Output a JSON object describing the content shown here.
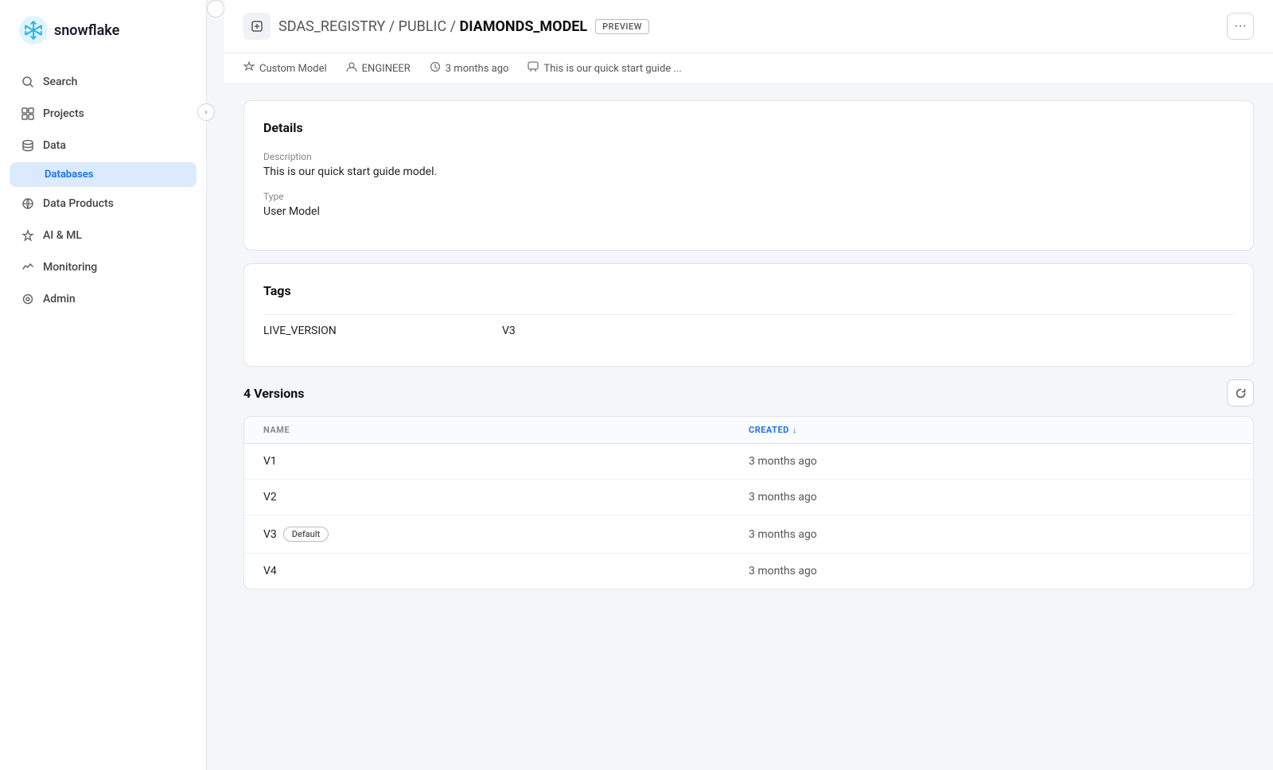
{
  "sidebar": {
    "logo_text": "snowflake",
    "items": [
      {
        "id": "search",
        "label": "Search",
        "icon": "🔍"
      },
      {
        "id": "projects",
        "label": "Projects",
        "icon": "⊞"
      },
      {
        "id": "data",
        "label": "Data",
        "icon": "🗄"
      },
      {
        "id": "databases",
        "label": "Databases",
        "icon": ""
      },
      {
        "id": "data-products",
        "label": "Data Products",
        "icon": "☁"
      },
      {
        "id": "ai-ml",
        "label": "AI & ML",
        "icon": "✦"
      },
      {
        "id": "monitoring",
        "label": "Monitoring",
        "icon": "〜"
      },
      {
        "id": "admin",
        "label": "Admin",
        "icon": "⊙"
      }
    ]
  },
  "header": {
    "icon": "⊟",
    "breadcrumb_part1": "SDAS_REGISTRY",
    "breadcrumb_sep1": " / ",
    "breadcrumb_part2": "PUBLIC",
    "breadcrumb_sep2": " / ",
    "breadcrumb_part3": "DIAMONDS_MODEL",
    "preview_label": "PREVIEW",
    "more_icon": "···"
  },
  "meta": {
    "type_icon": "✦",
    "type_label": "Custom Model",
    "author_icon": "👤",
    "author_label": "ENGINEER",
    "time_icon": "🕐",
    "time_label": "3 months ago",
    "desc_icon": "💬",
    "desc_label": "This is our quick start guide ..."
  },
  "details_card": {
    "title": "Details",
    "description_label": "Description",
    "description_value": "This is our quick start guide model.",
    "type_label": "Type",
    "type_value": "User Model"
  },
  "tags_card": {
    "title": "Tags",
    "tags": [
      {
        "key": "LIVE_VERSION",
        "value": "V3"
      }
    ]
  },
  "versions": {
    "count_label": "4 Versions",
    "refresh_icon": "↻",
    "col_name": "NAME",
    "col_created": "CREATED",
    "sort_icon": "↓",
    "rows": [
      {
        "name": "V1",
        "created": "3 months ago",
        "default": false
      },
      {
        "name": "V2",
        "created": "3 months ago",
        "default": false
      },
      {
        "name": "V3",
        "created": "3 months ago",
        "default": true
      },
      {
        "name": "V4",
        "created": "3 months ago",
        "default": false
      }
    ],
    "default_badge_label": "Default"
  }
}
